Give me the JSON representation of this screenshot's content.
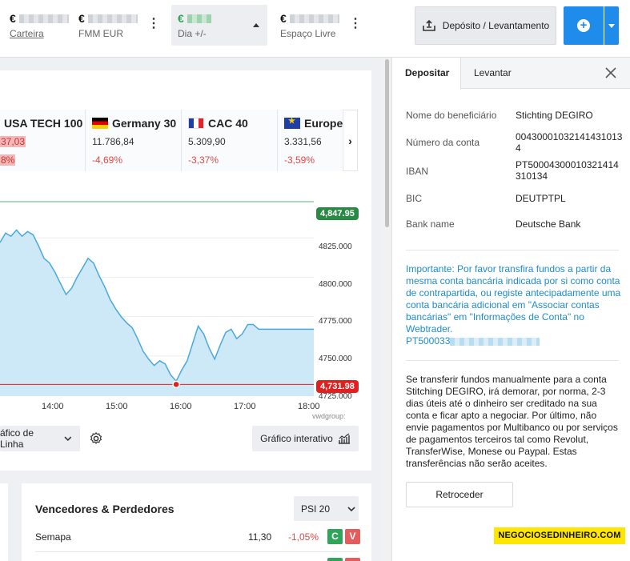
{
  "topbar": {
    "stats": [
      {
        "currency": "€",
        "label": "Carteira"
      },
      {
        "currency": "€",
        "label": "FMM EUR"
      },
      {
        "currency": "€",
        "label": "Dia +/-"
      },
      {
        "currency": "€",
        "label": "Espaço Livre"
      }
    ],
    "deposit_button": "Depósito / Levantamento"
  },
  "indices": [
    {
      "name": "USA TECH 100",
      "price": "37,03",
      "change": "8%",
      "flag": "none"
    },
    {
      "name": "Germany 30",
      "price": "11.786,84",
      "change": "-4,69%",
      "flag": "de"
    },
    {
      "name": "CAC 40",
      "price": "5.309,90",
      "change": "-3,37%",
      "flag": "fr"
    },
    {
      "name": "Europe",
      "price": "3.331,56",
      "change": "-3,59%",
      "flag": "eu"
    }
  ],
  "chart_data": {
    "type": "area",
    "title": "",
    "xlabel": "",
    "ylabel": "",
    "x_ticks": [
      "14:00",
      "15:00",
      "16:00",
      "17:00",
      "18:00"
    ],
    "y_ticks": [
      "4825.000",
      "4800.000",
      "4775.000",
      "4750.000",
      "4725.000"
    ],
    "ylim": [
      4723,
      4850
    ],
    "high": "4,847.95",
    "low": "4,731.98",
    "series": [
      {
        "values": [
          4822,
          4828,
          4826,
          4830,
          4826,
          4829,
          4827,
          4820,
          4812,
          4809,
          4803,
          4796,
          4789,
          4793,
          4800,
          4806,
          4812,
          4809,
          4801,
          4794,
          4786,
          4780,
          4775,
          4771,
          4768,
          4761,
          4753,
          4748,
          4744,
          4747,
          4745,
          4738,
          4734,
          4741,
          4747,
          4758,
          4769,
          4764,
          4755,
          4748,
          4757,
          4765,
          4767,
          4761,
          4764,
          4770,
          4770,
          4767,
          4767,
          4767,
          4767,
          4767,
          4767,
          4767,
          4767,
          4767,
          4767,
          4767
        ]
      }
    ],
    "source": "vwdgroup:"
  },
  "chart_controls": {
    "type_label": "áfico de Linha",
    "interactive_label": "Gráfico interativo"
  },
  "movers": {
    "title": "Vencedores & Perdedores",
    "index": "PSI 20",
    "rows": [
      {
        "name": "Semapa",
        "price": "11,30",
        "change": "-1,05%",
        "buy": "C",
        "sell": "V"
      }
    ]
  },
  "panel": {
    "tabs": [
      "Depositar",
      "Levantar"
    ],
    "fields": [
      {
        "key": "Nome do beneficiário",
        "value": "Stichting DEGIRO"
      },
      {
        "key": "Número da conta",
        "value": "004300010321414310134"
      },
      {
        "key": "IBAN",
        "value": "PT50004300010321414310134"
      },
      {
        "key": "BIC",
        "value": "DEUTPTPL"
      },
      {
        "key": "Bank name",
        "value": "Deutsche Bank"
      }
    ],
    "notice": "Importante: Por favor transfira fundos a partir da mesma conta bancária indicada por si como conta de contrapartida, ou registe antecipadamente uma conta bancária adicional em \"Associar contas bancárias\" em \"Informações de Conta\" no Webtrader.",
    "reference_prefix": "PT500033",
    "paragraph": "Se transferir fundos manualmente para a conta Stitching DEGIRO, irá demorar, por norma, 2-3 dias úteis até o dinheiro ser creditado na sua conta e ficar apto a negociar. Por último, não envie pagamentos por Multibanco ou por serviços de pagamentos terceiros tal como Revolut, TransferWise, Monese ou Paypal. Estas transferências não serão aceites.",
    "back_button": "Retroceder"
  },
  "watermark": "NEGOCIOSEDINHEIRO.COM",
  "colors": {
    "accent": "#1f8ceb",
    "loss": "#e04848",
    "gain": "#2fa55a",
    "area": "#cde8f7",
    "line": "#4aa8dc"
  }
}
